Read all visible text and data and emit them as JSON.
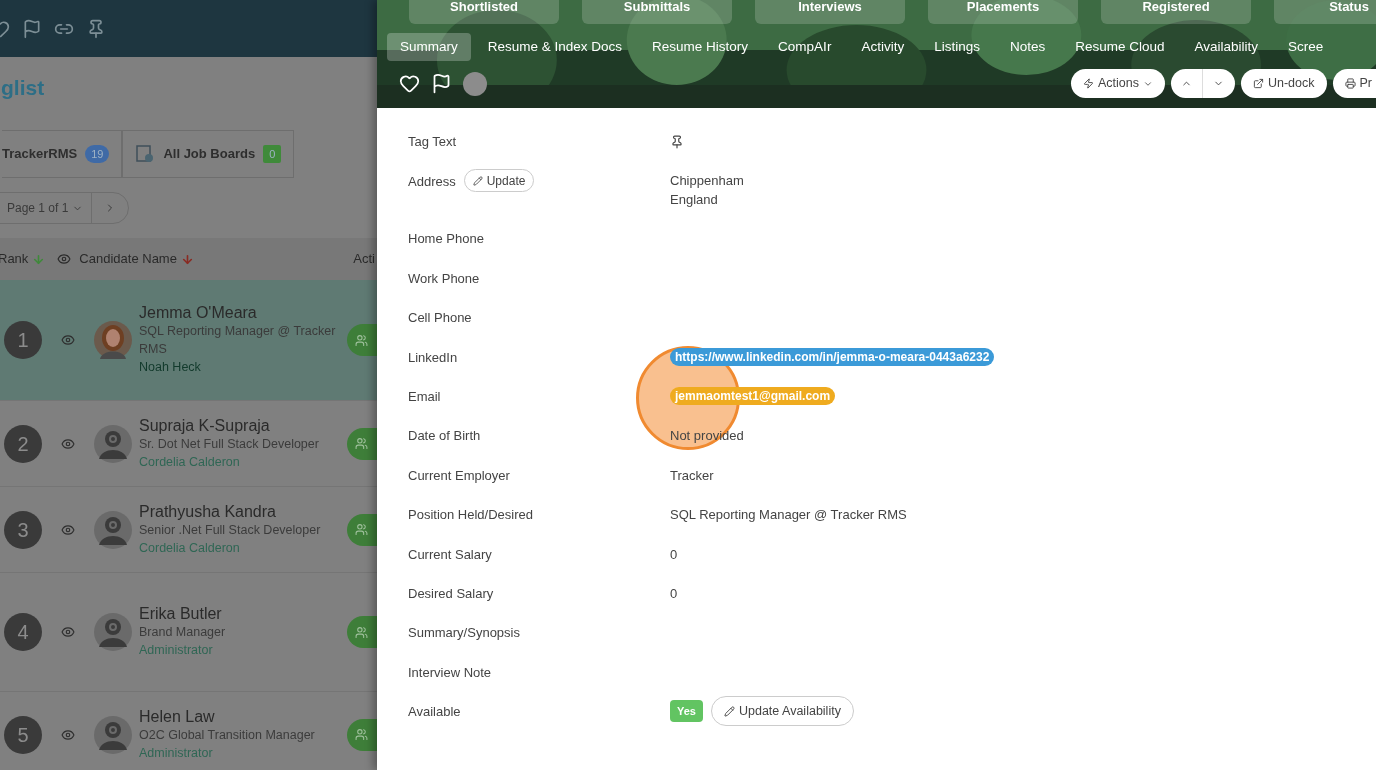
{
  "list_panel": {
    "title": "glist",
    "source_tabs": [
      {
        "label": "TrackerRMS",
        "count": "19",
        "color": "#3f6aa6"
      },
      {
        "label": "All Job Boards",
        "count": "0",
        "color": "#3f8a3a"
      }
    ],
    "pager": {
      "label": "Page 1 of 1"
    },
    "columns": [
      "Rank",
      "Candidate Name",
      "Acti"
    ],
    "candidates": [
      {
        "rank": "1",
        "name": "Jemma O'Meara",
        "title": "SQL Reporting Manager @ Tracker RMS",
        "owner": "Noah Heck",
        "selected": true
      },
      {
        "rank": "2",
        "name": "Supraja K-Supraja",
        "title": "Sr. Dot Net Full Stack Developer",
        "owner": "Cordelia Calderon",
        "selected": false,
        "kind": "unknown"
      },
      {
        "rank": "3",
        "name": "Prathyusha Kandra",
        "title": "Senior .Net Full Stack Developer",
        "owner": "Cordelia Calderon",
        "selected": false,
        "kind": "unknown"
      },
      {
        "rank": "4",
        "name": "Erika Butler",
        "title": "Brand Manager",
        "owner": "Administrator",
        "selected": false,
        "kind": "unknown"
      },
      {
        "rank": "5",
        "name": "Helen Law",
        "title": "O2C Global Transition Manager",
        "owner": "Administrator",
        "selected": false,
        "kind": "unknown"
      }
    ]
  },
  "record_panel": {
    "status_tabs": [
      "Shortlisted",
      "Submittals",
      "Interviews",
      "Placements",
      "Registered",
      "Status"
    ],
    "tabs": [
      {
        "label": "Summary",
        "selected": true
      },
      {
        "label": "Resume & Index Docs",
        "selected": false
      },
      {
        "label": "Resume History",
        "selected": false
      },
      {
        "label": "CompAIr",
        "selected": false
      },
      {
        "label": "Activity",
        "selected": false
      },
      {
        "label": "Listings",
        "selected": false
      },
      {
        "label": "Notes",
        "selected": false
      },
      {
        "label": "Resume Cloud",
        "selected": false
      },
      {
        "label": "Availability",
        "selected": false
      },
      {
        "label": "Scree",
        "selected": false
      }
    ],
    "buttons": {
      "actions": "Actions",
      "undock": "Un-dock",
      "print": "Pr"
    },
    "fields": [
      {
        "label": "Tag Text",
        "kind": "pin"
      },
      {
        "label": "Address",
        "kind": "address",
        "action": "Update",
        "lines": [
          "Chippenham",
          "England"
        ]
      },
      {
        "label": "Home Phone",
        "kind": "text"
      },
      {
        "label": "Work Phone",
        "kind": "text"
      },
      {
        "label": "Cell Phone",
        "kind": "text"
      },
      {
        "label": "LinkedIn",
        "kind": "pill",
        "value": "https://www.linkedin.com/in/jemma-o-meara-0443a6232",
        "color": "#3b9ad8"
      },
      {
        "label": "Email",
        "kind": "pill",
        "value": "jemmaomtest1@gmail.com",
        "color": "#efab1f"
      },
      {
        "label": "Date of Birth",
        "kind": "text",
        "value": "Not provided"
      },
      {
        "label": "Current Employer",
        "kind": "text",
        "value": "Tracker"
      },
      {
        "label": "Position Held/Desired",
        "kind": "text",
        "value": "SQL Reporting Manager @ Tracker RMS"
      },
      {
        "label": "Current Salary",
        "kind": "text",
        "value": "0"
      },
      {
        "label": "Desired Salary",
        "kind": "text",
        "value": "0"
      },
      {
        "label": "Summary/Synopsis",
        "kind": "text"
      },
      {
        "label": "Interview Note",
        "kind": "text"
      },
      {
        "label": "Available",
        "kind": "availability",
        "badge": "Yes",
        "action": "Update Availability"
      }
    ]
  }
}
